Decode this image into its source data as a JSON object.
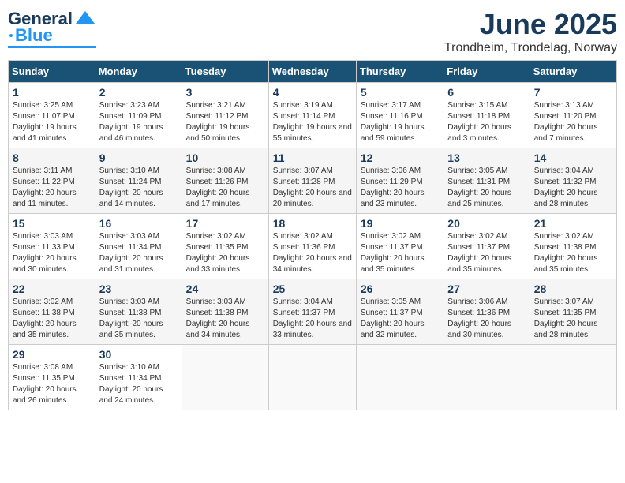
{
  "logo": {
    "line1": "General",
    "line2": "Blue"
  },
  "title": "June 2025",
  "location": "Trondheim, Trondelag, Norway",
  "weekdays": [
    "Sunday",
    "Monday",
    "Tuesday",
    "Wednesday",
    "Thursday",
    "Friday",
    "Saturday"
  ],
  "weeks": [
    [
      {
        "day": "1",
        "sunrise": "Sunrise: 3:25 AM",
        "sunset": "Sunset: 11:07 PM",
        "daylight": "Daylight: 19 hours and 41 minutes."
      },
      {
        "day": "2",
        "sunrise": "Sunrise: 3:23 AM",
        "sunset": "Sunset: 11:09 PM",
        "daylight": "Daylight: 19 hours and 46 minutes."
      },
      {
        "day": "3",
        "sunrise": "Sunrise: 3:21 AM",
        "sunset": "Sunset: 11:12 PM",
        "daylight": "Daylight: 19 hours and 50 minutes."
      },
      {
        "day": "4",
        "sunrise": "Sunrise: 3:19 AM",
        "sunset": "Sunset: 11:14 PM",
        "daylight": "Daylight: 19 hours and 55 minutes."
      },
      {
        "day": "5",
        "sunrise": "Sunrise: 3:17 AM",
        "sunset": "Sunset: 11:16 PM",
        "daylight": "Daylight: 19 hours and 59 minutes."
      },
      {
        "day": "6",
        "sunrise": "Sunrise: 3:15 AM",
        "sunset": "Sunset: 11:18 PM",
        "daylight": "Daylight: 20 hours and 3 minutes."
      },
      {
        "day": "7",
        "sunrise": "Sunrise: 3:13 AM",
        "sunset": "Sunset: 11:20 PM",
        "daylight": "Daylight: 20 hours and 7 minutes."
      }
    ],
    [
      {
        "day": "8",
        "sunrise": "Sunrise: 3:11 AM",
        "sunset": "Sunset: 11:22 PM",
        "daylight": "Daylight: 20 hours and 11 minutes."
      },
      {
        "day": "9",
        "sunrise": "Sunrise: 3:10 AM",
        "sunset": "Sunset: 11:24 PM",
        "daylight": "Daylight: 20 hours and 14 minutes."
      },
      {
        "day": "10",
        "sunrise": "Sunrise: 3:08 AM",
        "sunset": "Sunset: 11:26 PM",
        "daylight": "Daylight: 20 hours and 17 minutes."
      },
      {
        "day": "11",
        "sunrise": "Sunrise: 3:07 AM",
        "sunset": "Sunset: 11:28 PM",
        "daylight": "Daylight: 20 hours and 20 minutes."
      },
      {
        "day": "12",
        "sunrise": "Sunrise: 3:06 AM",
        "sunset": "Sunset: 11:29 PM",
        "daylight": "Daylight: 20 hours and 23 minutes."
      },
      {
        "day": "13",
        "sunrise": "Sunrise: 3:05 AM",
        "sunset": "Sunset: 11:31 PM",
        "daylight": "Daylight: 20 hours and 25 minutes."
      },
      {
        "day": "14",
        "sunrise": "Sunrise: 3:04 AM",
        "sunset": "Sunset: 11:32 PM",
        "daylight": "Daylight: 20 hours and 28 minutes."
      }
    ],
    [
      {
        "day": "15",
        "sunrise": "Sunrise: 3:03 AM",
        "sunset": "Sunset: 11:33 PM",
        "daylight": "Daylight: 20 hours and 30 minutes."
      },
      {
        "day": "16",
        "sunrise": "Sunrise: 3:03 AM",
        "sunset": "Sunset: 11:34 PM",
        "daylight": "Daylight: 20 hours and 31 minutes."
      },
      {
        "day": "17",
        "sunrise": "Sunrise: 3:02 AM",
        "sunset": "Sunset: 11:35 PM",
        "daylight": "Daylight: 20 hours and 33 minutes."
      },
      {
        "day": "18",
        "sunrise": "Sunrise: 3:02 AM",
        "sunset": "Sunset: 11:36 PM",
        "daylight": "Daylight: 20 hours and 34 minutes."
      },
      {
        "day": "19",
        "sunrise": "Sunrise: 3:02 AM",
        "sunset": "Sunset: 11:37 PM",
        "daylight": "Daylight: 20 hours and 35 minutes."
      },
      {
        "day": "20",
        "sunrise": "Sunrise: 3:02 AM",
        "sunset": "Sunset: 11:37 PM",
        "daylight": "Daylight: 20 hours and 35 minutes."
      },
      {
        "day": "21",
        "sunrise": "Sunrise: 3:02 AM",
        "sunset": "Sunset: 11:38 PM",
        "daylight": "Daylight: 20 hours and 35 minutes."
      }
    ],
    [
      {
        "day": "22",
        "sunrise": "Sunrise: 3:02 AM",
        "sunset": "Sunset: 11:38 PM",
        "daylight": "Daylight: 20 hours and 35 minutes."
      },
      {
        "day": "23",
        "sunrise": "Sunrise: 3:03 AM",
        "sunset": "Sunset: 11:38 PM",
        "daylight": "Daylight: 20 hours and 35 minutes."
      },
      {
        "day": "24",
        "sunrise": "Sunrise: 3:03 AM",
        "sunset": "Sunset: 11:38 PM",
        "daylight": "Daylight: 20 hours and 34 minutes."
      },
      {
        "day": "25",
        "sunrise": "Sunrise: 3:04 AM",
        "sunset": "Sunset: 11:37 PM",
        "daylight": "Daylight: 20 hours and 33 minutes."
      },
      {
        "day": "26",
        "sunrise": "Sunrise: 3:05 AM",
        "sunset": "Sunset: 11:37 PM",
        "daylight": "Daylight: 20 hours and 32 minutes."
      },
      {
        "day": "27",
        "sunrise": "Sunrise: 3:06 AM",
        "sunset": "Sunset: 11:36 PM",
        "daylight": "Daylight: 20 hours and 30 minutes."
      },
      {
        "day": "28",
        "sunrise": "Sunrise: 3:07 AM",
        "sunset": "Sunset: 11:35 PM",
        "daylight": "Daylight: 20 hours and 28 minutes."
      }
    ],
    [
      {
        "day": "29",
        "sunrise": "Sunrise: 3:08 AM",
        "sunset": "Sunset: 11:35 PM",
        "daylight": "Daylight: 20 hours and 26 minutes."
      },
      {
        "day": "30",
        "sunrise": "Sunrise: 3:10 AM",
        "sunset": "Sunset: 11:34 PM",
        "daylight": "Daylight: 20 hours and 24 minutes."
      },
      null,
      null,
      null,
      null,
      null
    ]
  ]
}
